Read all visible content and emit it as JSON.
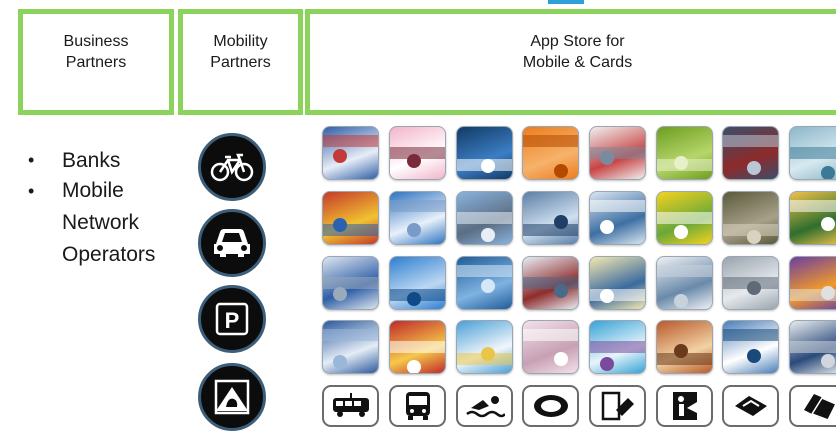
{
  "headers": {
    "business_partners": [
      "Business",
      "Partners"
    ],
    "mobility_partners": [
      "Mobility",
      "Partners"
    ],
    "app_store": [
      "App Store for",
      "Mobile & Cards"
    ]
  },
  "business_partners_list": [
    "Banks",
    "Mobile",
    "Network",
    "Operators"
  ],
  "mobility_icons": [
    "bicycle-icon",
    "car-icon",
    "parking-icon",
    "hand-card-icon"
  ],
  "app_tiles": {
    "rows": 4,
    "columns": 8
  },
  "pictogram_row": [
    "tram-icon",
    "bus-icon",
    "swimming-icon",
    "stadium-icon",
    "door-card-icon",
    "info-card-icon",
    "ticket-icon",
    "hand-cards-icon"
  ],
  "colors": {
    "accent_green": "#8bd35a",
    "accent_blue": "#2f9fd8",
    "icon_ring": "#3d5e7a"
  }
}
